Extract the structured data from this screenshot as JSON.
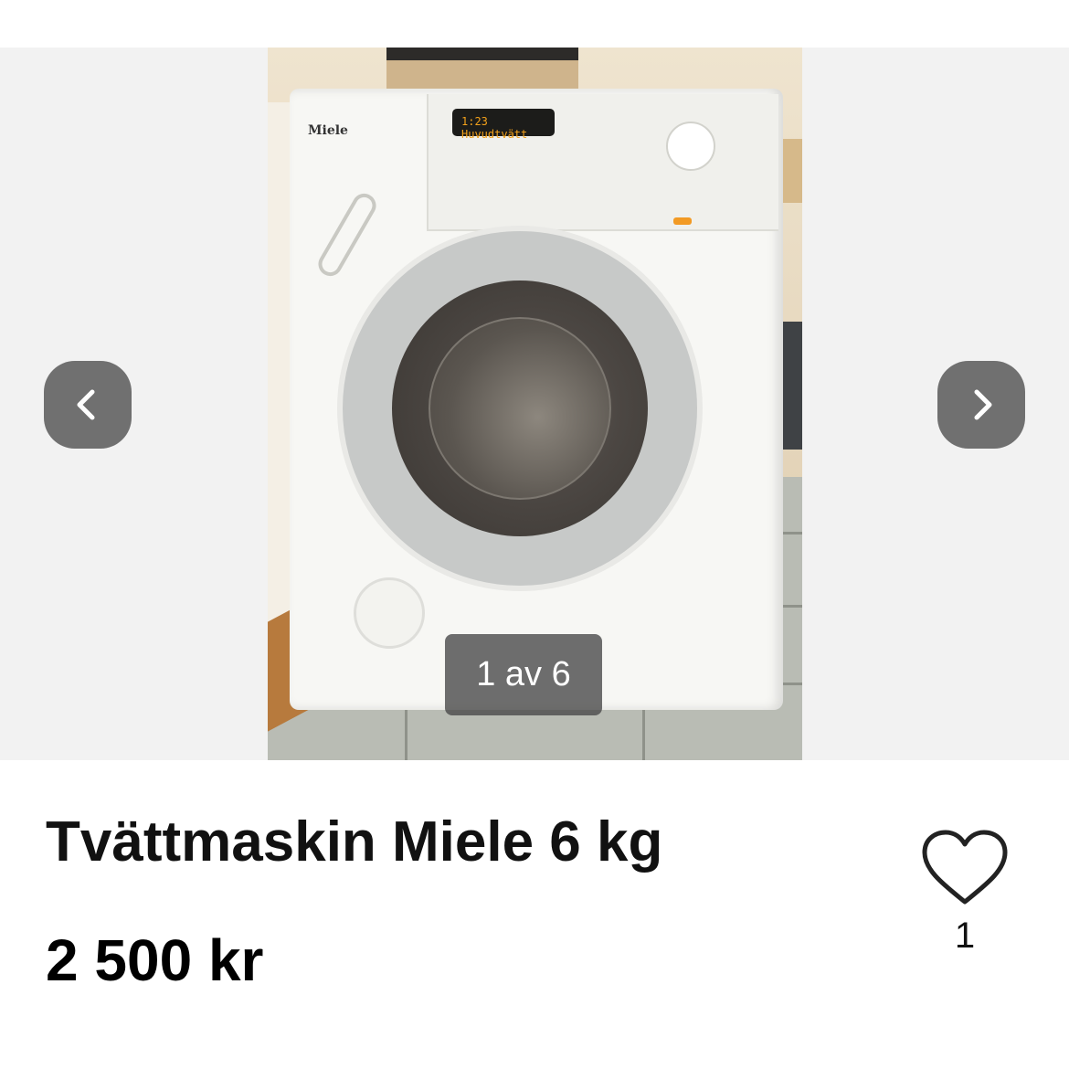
{
  "gallery": {
    "counter": "1 av 6",
    "prev_icon": "chevron-left-icon",
    "next_icon": "chevron-right-icon",
    "photo": {
      "brand": "Miele",
      "display": "1:23  Huvudtvätt"
    }
  },
  "listing": {
    "title": "Tvättmaskin Miele 6 kg",
    "price": "2 500 kr"
  },
  "favorite": {
    "icon": "heart-icon",
    "count": "1"
  },
  "colors": {
    "nav_button": "#707070",
    "gallery_bg": "#f2f2f2",
    "text": "#111111"
  }
}
